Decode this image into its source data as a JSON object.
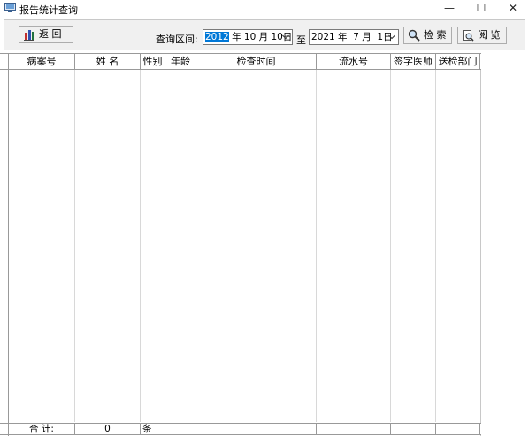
{
  "window": {
    "title": "报告统计查询",
    "minimize": "—",
    "maximize": "☐",
    "close": "✕"
  },
  "toolbar": {
    "back_label": "返 回",
    "query_range_label": "查询区间:",
    "start_date_year_selected": "2012",
    "start_date_rest": " 年 10 月 10日",
    "to_label": "至",
    "end_date": "2021 年  7 月  1日",
    "search_label": "检 索",
    "browse_label": "阅 览"
  },
  "table": {
    "columns": [
      "病案号",
      "姓 名",
      "性别",
      "年龄",
      "检查时间",
      "流水号",
      "签字医师",
      "送检部门"
    ]
  },
  "footer": {
    "total_label": "合    计:",
    "count": "0",
    "unit": "条"
  }
}
